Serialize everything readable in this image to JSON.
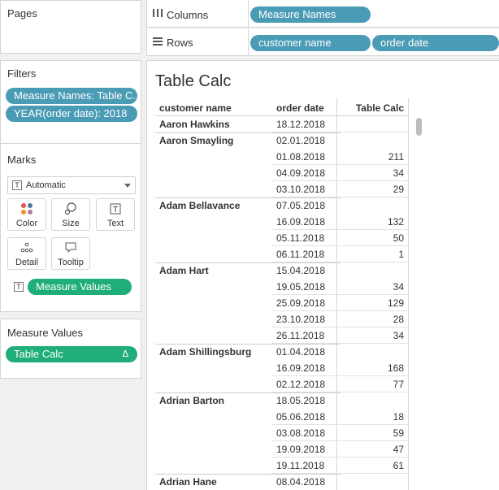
{
  "pages": {
    "title": "Pages"
  },
  "filters": {
    "title": "Filters",
    "items": [
      "Measure Names: Table C..",
      "YEAR(order date): 2018"
    ]
  },
  "marks": {
    "title": "Marks",
    "type_icon": "T",
    "type_label": "Automatic",
    "buttons": [
      {
        "label": "Color",
        "icon": "color-dots-icon"
      },
      {
        "label": "Size",
        "icon": "size-icon"
      },
      {
        "label": "Text",
        "icon": "text-icon"
      },
      {
        "label": "Detail",
        "icon": "detail-icon"
      },
      {
        "label": "Tooltip",
        "icon": "tooltip-icon"
      }
    ],
    "text_pill_icon": "T",
    "text_pill": "Measure Values"
  },
  "measure_values": {
    "title": "Measure Values",
    "pill": "Table Calc",
    "pill_delta": "Δ"
  },
  "shelves": {
    "columns_label": "Columns",
    "rows_label": "Rows",
    "columns_pills": [
      "Measure Names"
    ],
    "rows_pills": [
      "customer name",
      "order date"
    ]
  },
  "viz": {
    "title": "Table Calc",
    "headers": {
      "customer": "customer name",
      "date": "order date",
      "value": "Table Calc"
    },
    "groups": [
      {
        "customer": "Aaron Hawkins",
        "rows": [
          {
            "date": "18.12.2018",
            "value": ""
          }
        ]
      },
      {
        "customer": "Aaron Smayling",
        "rows": [
          {
            "date": "02.01.2018",
            "value": ""
          },
          {
            "date": "01.08.2018",
            "value": "211"
          },
          {
            "date": "04.09.2018",
            "value": "34"
          },
          {
            "date": "03.10.2018",
            "value": "29"
          }
        ]
      },
      {
        "customer": "Adam Bellavance",
        "rows": [
          {
            "date": "07.05.2018",
            "value": ""
          },
          {
            "date": "16.09.2018",
            "value": "132"
          },
          {
            "date": "05.11.2018",
            "value": "50"
          },
          {
            "date": "06.11.2018",
            "value": "1"
          }
        ]
      },
      {
        "customer": "Adam Hart",
        "rows": [
          {
            "date": "15.04.2018",
            "value": ""
          },
          {
            "date": "19.05.2018",
            "value": "34"
          },
          {
            "date": "25.09.2018",
            "value": "129"
          },
          {
            "date": "23.10.2018",
            "value": "28"
          },
          {
            "date": "26.11.2018",
            "value": "34"
          }
        ]
      },
      {
        "customer": "Adam Shillingsburg",
        "rows": [
          {
            "date": "01.04.2018",
            "value": ""
          },
          {
            "date": "16.09.2018",
            "value": "168"
          },
          {
            "date": "02.12.2018",
            "value": "77"
          }
        ]
      },
      {
        "customer": "Adrian Barton",
        "rows": [
          {
            "date": "18.05.2018",
            "value": ""
          },
          {
            "date": "05.06.2018",
            "value": "18"
          },
          {
            "date": "03.08.2018",
            "value": "59"
          },
          {
            "date": "19.09.2018",
            "value": "47"
          },
          {
            "date": "19.11.2018",
            "value": "61"
          }
        ]
      },
      {
        "customer": "Adrian Hane",
        "rows": [
          {
            "date": "08.04.2018",
            "value": ""
          }
        ]
      }
    ]
  }
}
